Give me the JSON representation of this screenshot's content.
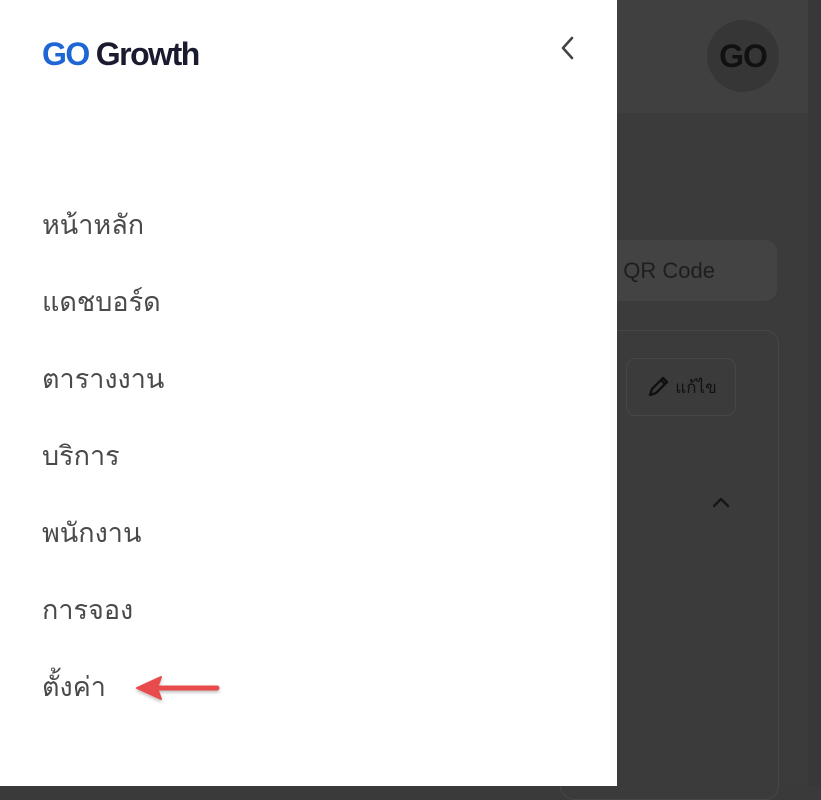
{
  "drawer": {
    "logo": {
      "go": "GO",
      "growth": "Growth",
      "accent_color": "#1d66d4"
    },
    "collapse_icon": "chevron-left-icon",
    "menu": [
      {
        "label": "หน้าหลัก"
      },
      {
        "label": "แดชบอร์ด"
      },
      {
        "label": "ตารางงาน"
      },
      {
        "label": "บริการ"
      },
      {
        "label": "พนักงาน"
      },
      {
        "label": "การจอง"
      },
      {
        "label": "ตั้งค่า"
      }
    ]
  },
  "background": {
    "avatar_text": "GO",
    "qr_button_label": "QR Code",
    "edit_button_label": "แก้ไข",
    "edit_icon": "pencil-icon",
    "expand_icon": "chevron-up-icon"
  },
  "annotation": {
    "arrow_icon": "red-arrow-icon",
    "arrow_color": "#e84b4b"
  }
}
